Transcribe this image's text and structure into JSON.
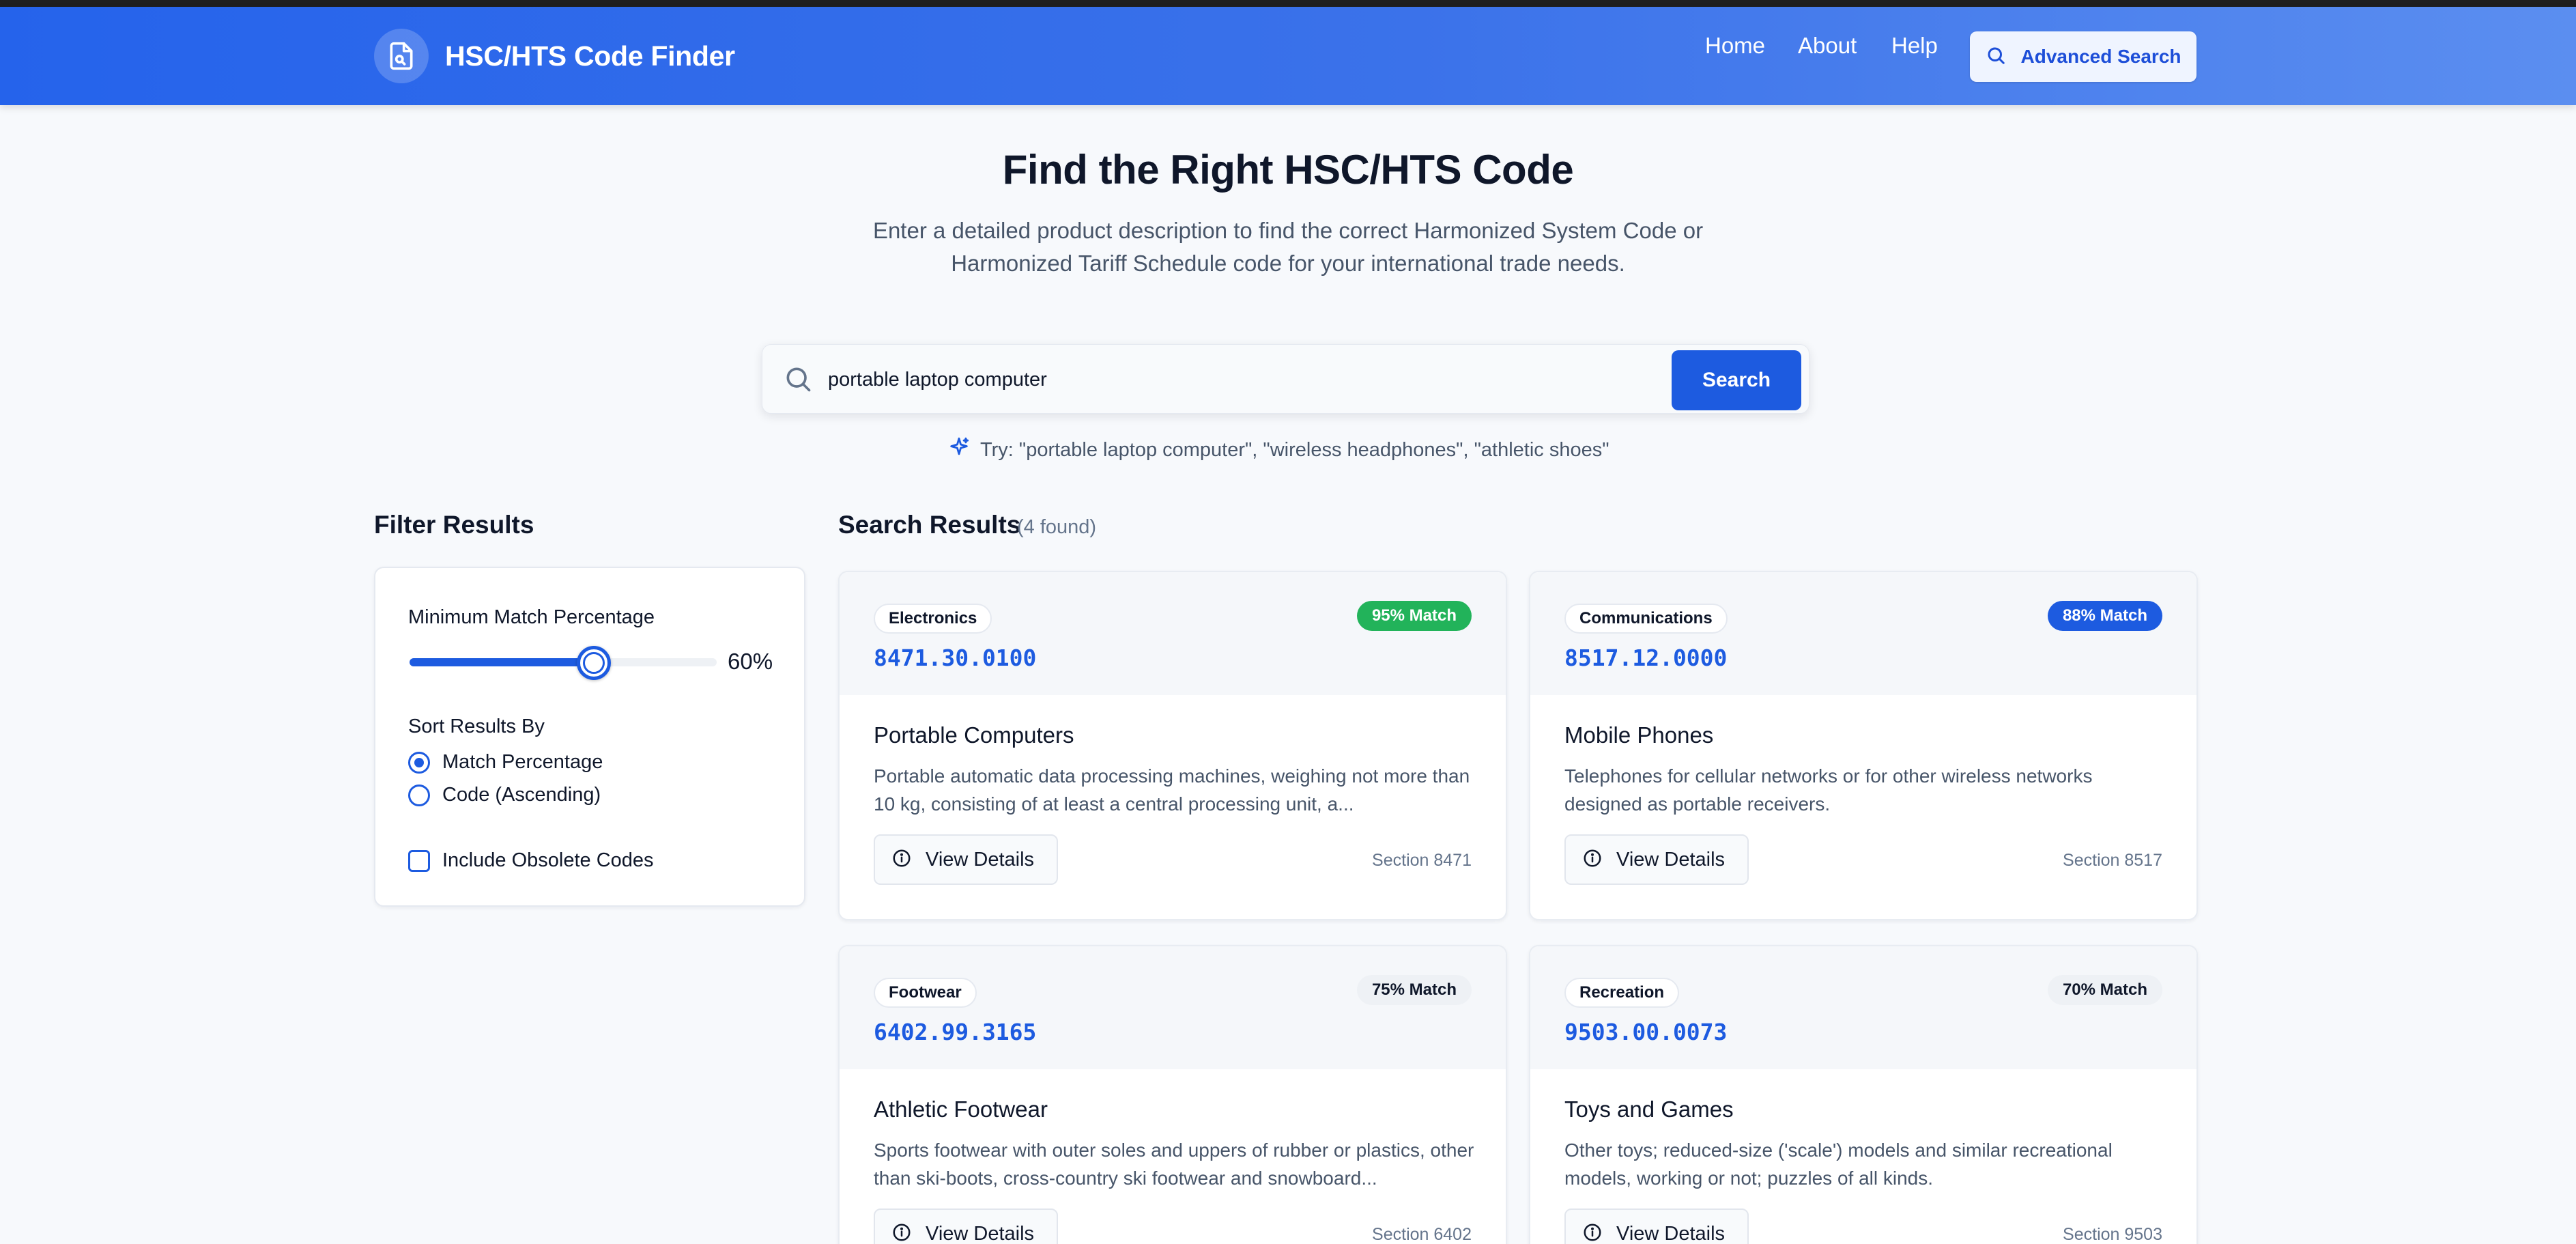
{
  "header": {
    "title": "HSC/HTS Code Finder",
    "nav": [
      "Home",
      "About",
      "Help"
    ],
    "advanced_search_label": "Advanced Search"
  },
  "hero": {
    "title": "Find the Right HSC/HTS Code",
    "subtitle": "Enter a detailed product description to find the correct Harmonized System Code or Harmonized Tariff Schedule code for your international trade needs."
  },
  "search": {
    "value": "portable laptop computer",
    "button_label": "Search",
    "suggestions": "Try: \"portable laptop computer\", \"wireless headphones\", \"athletic shoes\""
  },
  "filters": {
    "title": "Filter Results",
    "min_match_label": "Minimum Match Percentage",
    "min_match_value": 60,
    "min_match_display": "60%",
    "sort_label": "Sort Results By",
    "sort_options": [
      "Match Percentage",
      "Code (Ascending)"
    ],
    "sort_selected": "Match Percentage",
    "include_obsolete_label": "Include Obsolete Codes",
    "include_obsolete_checked": false
  },
  "results": {
    "title": "Search Results",
    "count_text": "(4 found)",
    "view_details_label": "View Details",
    "items": [
      {
        "category": "Electronics",
        "match": "95% Match",
        "match_style": "green",
        "code": "8471.30.0100",
        "title": "Portable Computers",
        "description": "Portable automatic data processing machines, weighing not more than 10 kg, consisting of at least a central processing unit, a...",
        "section": "Section 8471"
      },
      {
        "category": "Communications",
        "match": "88% Match",
        "match_style": "blue",
        "code": "8517.12.0000",
        "title": "Mobile Phones",
        "description": "Telephones for cellular networks or for other wireless networks designed as portable receivers.",
        "section": "Section 8517"
      },
      {
        "category": "Footwear",
        "match": "75% Match",
        "match_style": "gray",
        "code": "6402.99.3165",
        "title": "Athletic Footwear",
        "description": "Sports footwear with outer soles and uppers of rubber or plastics, other than ski-boots, cross-country ski footwear and snowboard...",
        "section": "Section 6402"
      },
      {
        "category": "Recreation",
        "match": "70% Match",
        "match_style": "gray",
        "code": "9503.00.0073",
        "title": "Toys and Games",
        "description": "Other toys; reduced-size ('scale') models and similar recreational models, working or not; puzzles of all kinds.",
        "section": "Section 9503"
      }
    ]
  },
  "colors": {
    "header_gradient_start": "#2563eb",
    "primary": "#1d5be0",
    "match_green": "#22b35a",
    "match_blue": "#1d5be0",
    "match_gray_bg": "#eef1f5"
  }
}
